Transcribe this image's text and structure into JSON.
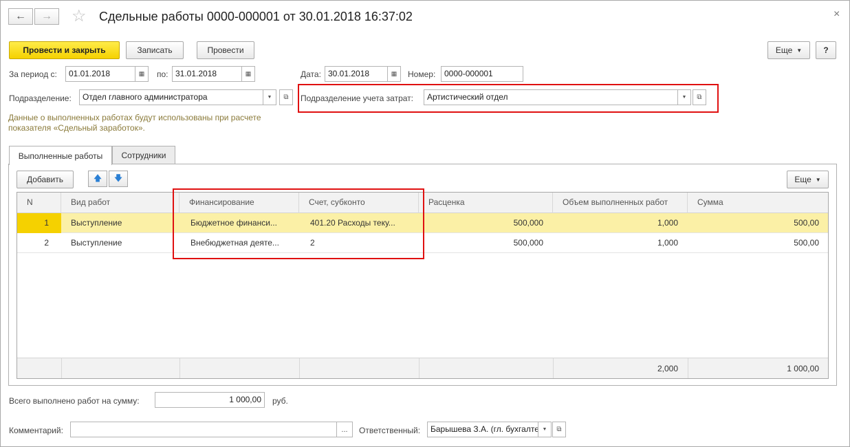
{
  "window": {
    "title": "Сдельные работы 0000-000001 от 30.01.2018 16:37:02",
    "close_symbol": "×"
  },
  "toolbar": {
    "post_close_label": "Провести и закрыть",
    "save_label": "Записать",
    "post_label": "Провести",
    "more_label": "Еще",
    "help_label": "?"
  },
  "form": {
    "period_from_label": "За период с:",
    "period_from": "01.01.2018",
    "period_to_label": "по:",
    "period_to": "31.01.2018",
    "date_label": "Дата:",
    "date": "30.01.2018",
    "number_label": "Номер:",
    "number": "0000-000001",
    "department_label": "Подразделение:",
    "department": "Отдел главного администратора",
    "cost_department_label": "Подразделение учета затрат:",
    "cost_department": "Артистический отдел",
    "hint": "Данные о выполненных работах будут использованы при расчете показателя «Сдельный заработок»."
  },
  "tabs": [
    {
      "label": "Выполненные работы"
    },
    {
      "label": "Сотрудники"
    }
  ],
  "table_toolbar": {
    "add_label": "Добавить",
    "more_label": "Еще"
  },
  "table": {
    "columns": [
      "N",
      "Вид работ",
      "Финансирование",
      "Счет, субконто",
      "Расценка",
      "Объем выполненных работ",
      "Сумма"
    ],
    "rows": [
      {
        "n": "1",
        "work": "Выступление",
        "financing": "Бюджетное финанси...",
        "account": "401.20 Расходы теку...",
        "rate": "500,000",
        "volume": "1,000",
        "sum": "500,00"
      },
      {
        "n": "2",
        "work": "Выступление",
        "financing": "Внебюджетная деяте...",
        "account": "2",
        "rate": "500,000",
        "volume": "1,000",
        "sum": "500,00"
      }
    ],
    "totals": {
      "volume": "2,000",
      "sum": "1 000,00"
    }
  },
  "bottom": {
    "total_label": "Всего выполнено работ на сумму:",
    "total_value": "1 000,00",
    "currency": "руб.",
    "comment_label": "Комментарий:",
    "comment": "",
    "comment_btn": "...",
    "responsible_label": "Ответственный:",
    "responsible": "Барышева З.А. (гл. бухгалтер)"
  },
  "colors": {
    "primary_button": "#f5d100",
    "selected_row": "#fbf0a6",
    "highlight_border": "#e01010",
    "hint_text": "#8a7a3a"
  }
}
